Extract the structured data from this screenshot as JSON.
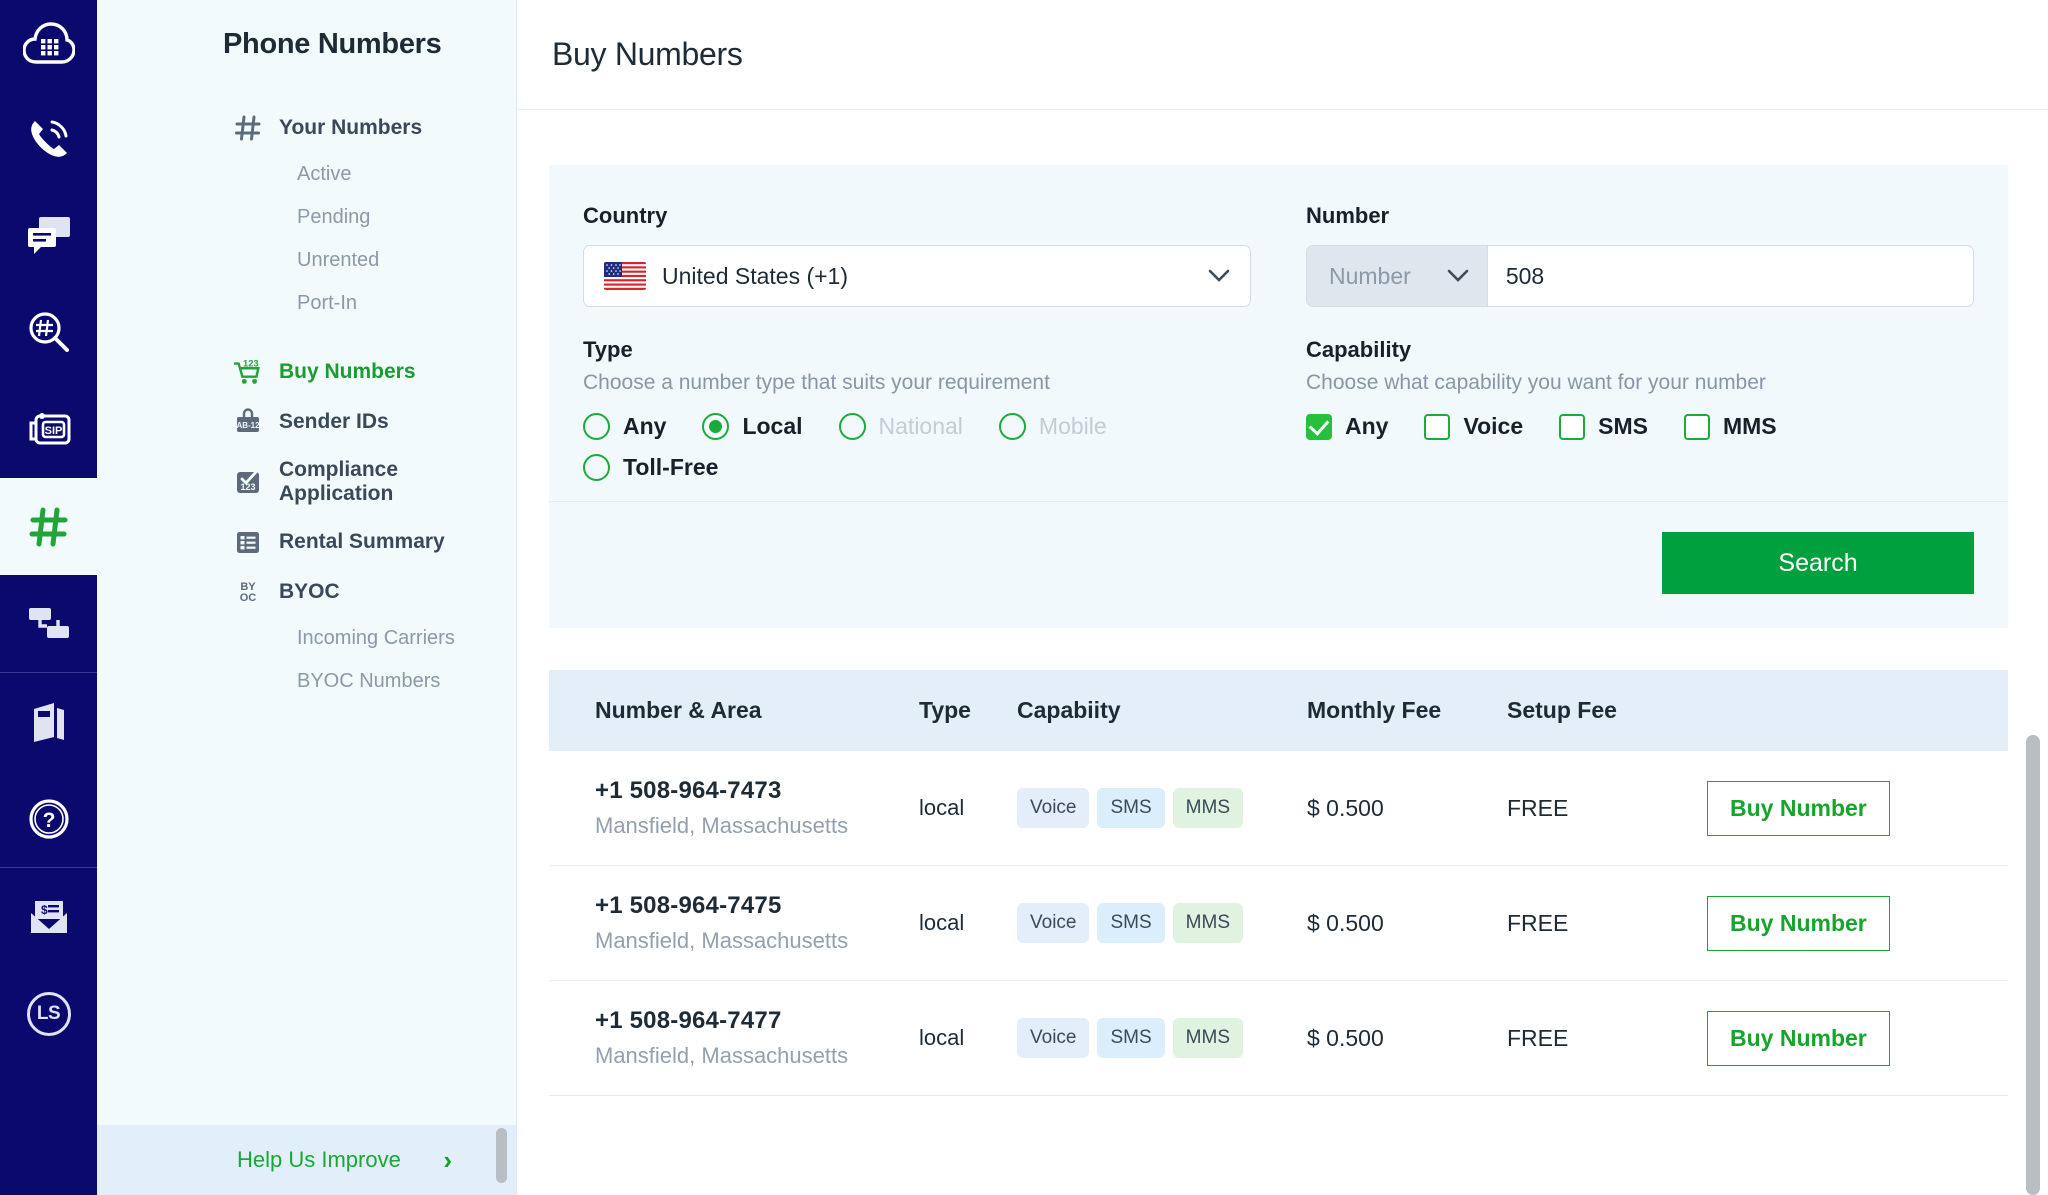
{
  "rail": {
    "items": [
      {
        "name": "cloud-logo-icon",
        "label": "Cloud"
      },
      {
        "name": "voice-icon",
        "label": "Voice"
      },
      {
        "name": "messaging-icon",
        "label": "Messaging"
      },
      {
        "name": "number-lookup-icon",
        "label": "Number Lookup"
      },
      {
        "name": "sip-icon",
        "label": "SIP"
      },
      {
        "name": "phone-numbers-icon",
        "label": "Phone Numbers"
      },
      {
        "name": "flows-icon",
        "label": "Flows"
      },
      {
        "name": "docs-icon",
        "label": "Docs"
      },
      {
        "name": "help-icon",
        "label": "Help"
      },
      {
        "name": "billing-icon",
        "label": "Billing"
      }
    ],
    "avatar_initials": "LS",
    "active_index": 5
  },
  "sidebar": {
    "title": "Phone Numbers",
    "groups": [
      {
        "label": "Your Numbers",
        "icon": "hash-icon",
        "accent": false,
        "children": [
          "Active",
          "Pending",
          "Unrented",
          "Port-In"
        ]
      },
      {
        "label": "Buy Numbers",
        "icon": "cart-123-icon",
        "accent": true,
        "children": []
      },
      {
        "label": "Sender IDs",
        "icon": "sender-id-icon",
        "accent": false,
        "children": []
      },
      {
        "label": "Compliance Application",
        "icon": "compliance-icon",
        "accent": false,
        "children": []
      },
      {
        "label": "Rental Summary",
        "icon": "rental-summary-icon",
        "accent": false,
        "children": []
      },
      {
        "label": "BYOC",
        "icon": "byoc-icon",
        "accent": false,
        "children": [
          "Incoming Carriers",
          "BYOC Numbers"
        ]
      }
    ],
    "help": {
      "label": "Help Us Improve",
      "chevron": "›"
    }
  },
  "header": {
    "title": "Buy Numbers"
  },
  "form": {
    "country": {
      "label": "Country",
      "value": "United States (+1)",
      "flag": "us-flag-icon",
      "chevron": "⌄"
    },
    "number": {
      "label": "Number",
      "prefix_value": "Number",
      "prefix_chevron": "⌄",
      "input_value": "508",
      "input_placeholder": "508"
    },
    "type": {
      "label": "Type",
      "hint": "Choose a number type that suits your requirement",
      "options": [
        {
          "label": "Any",
          "selected": false,
          "disabled": false
        },
        {
          "label": "Local",
          "selected": true,
          "disabled": false
        },
        {
          "label": "National",
          "selected": false,
          "disabled": true
        },
        {
          "label": "Mobile",
          "selected": false,
          "disabled": true
        },
        {
          "label": "Toll-Free",
          "selected": false,
          "disabled": false
        }
      ]
    },
    "capability": {
      "label": "Capability",
      "hint": "Choose what capability you want for your number",
      "options": [
        {
          "label": "Any",
          "checked": true
        },
        {
          "label": "Voice",
          "checked": false
        },
        {
          "label": "SMS",
          "checked": false
        },
        {
          "label": "MMS",
          "checked": false
        }
      ]
    },
    "search_label": "Search"
  },
  "results": {
    "columns": [
      "Number & Area",
      "Type",
      "Capabiity",
      "Monthly Fee",
      "Setup Fee",
      ""
    ],
    "rows": [
      {
        "number": "+1 508-964-7473",
        "area": "Mansfield, Massachusetts",
        "type": "local",
        "capabilities": [
          "Voice",
          "SMS",
          "MMS"
        ],
        "monthly_fee": "$ 0.500",
        "setup_fee": "FREE",
        "action": "Buy Number"
      },
      {
        "number": "+1 508-964-7475",
        "area": "Mansfield, Massachusetts",
        "type": "local",
        "capabilities": [
          "Voice",
          "SMS",
          "MMS"
        ],
        "monthly_fee": "$ 0.500",
        "setup_fee": "FREE",
        "action": "Buy Number"
      },
      {
        "number": "+1 508-964-7477",
        "area": "Mansfield, Massachusetts",
        "type": "local",
        "capabilities": [
          "Voice",
          "SMS",
          "MMS"
        ],
        "monthly_fee": "$ 0.500",
        "setup_fee": "FREE",
        "action": "Buy Number"
      }
    ]
  },
  "colors": {
    "rail_bg": "#0a0a6e",
    "sidebar_bg": "#f2fafc",
    "accent_green": "#1aab3a",
    "button_green": "#00a03e",
    "panel_bg": "#f1f9fc",
    "table_header_bg": "#e4eef8"
  }
}
